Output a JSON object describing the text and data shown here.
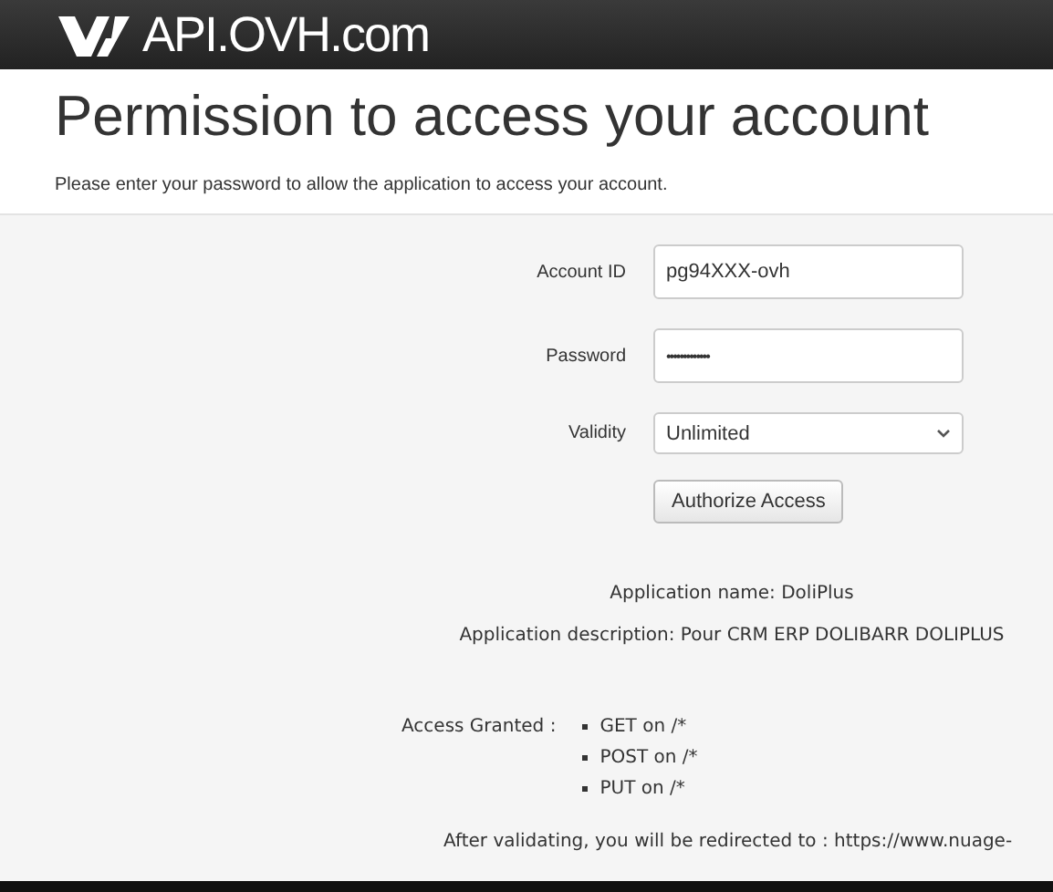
{
  "header": {
    "logo_text": "API.OVH.com"
  },
  "title": "Permission to access your account",
  "subtitle": "Please enter your password to allow the application to access your account.",
  "form": {
    "fields": [
      {
        "kind": "text",
        "label": "Account ID",
        "value": "pg94XXX-ovh"
      },
      {
        "kind": "password",
        "label": "Password",
        "value": "•••••••••••••"
      },
      {
        "kind": "select",
        "label": "Validity",
        "value": "Unlimited"
      }
    ],
    "submit": "Authorize Access"
  },
  "application_name": "Application name: DoliPlus",
  "application_description": "Application description: Pour CRM ERP DOLIBARR DOLIPLUS",
  "access_granted": {
    "label": "Access Granted :",
    "items": [
      "GET on /*",
      "POST on /*",
      "PUT on /*"
    ]
  },
  "redirect_note": "After validating, you will be redirected to : https://www.nuage-"
}
